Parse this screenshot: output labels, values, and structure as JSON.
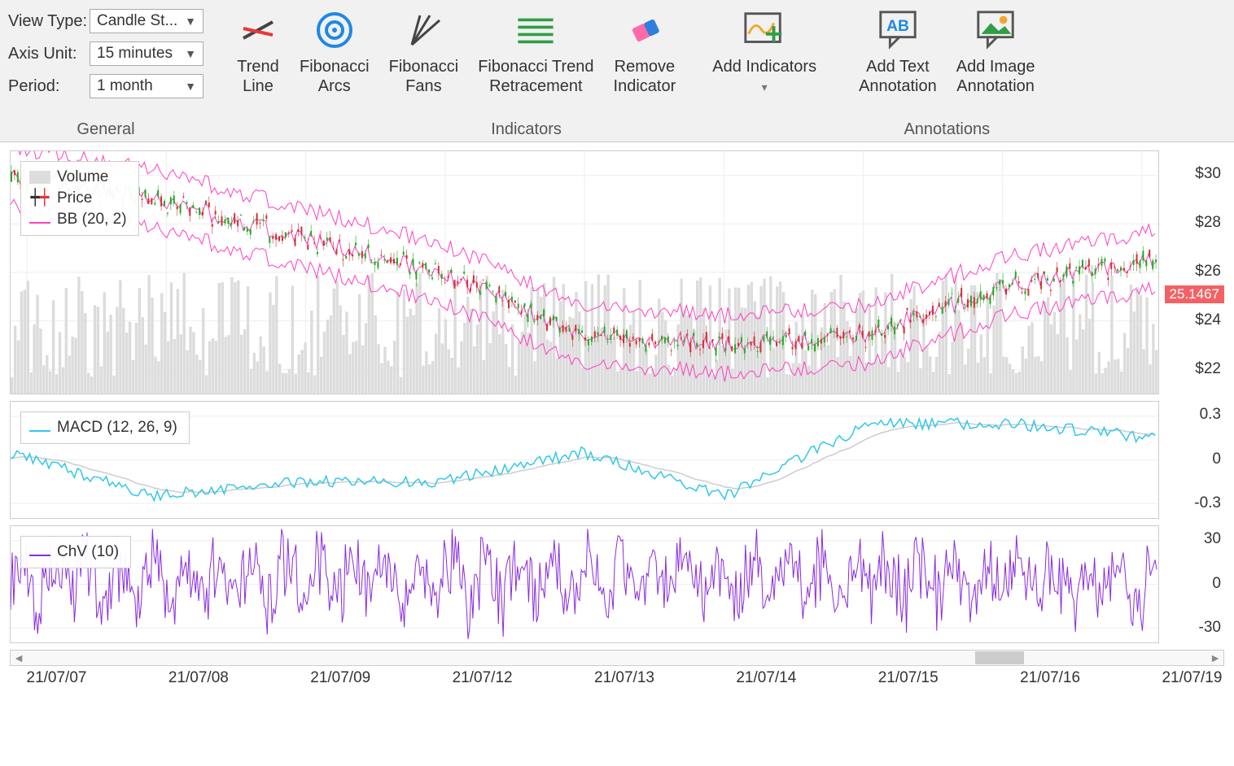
{
  "ribbon": {
    "general": {
      "title": "General",
      "view_type_label": "View Type:",
      "view_type_value": "Candle St...",
      "axis_unit_label": "Axis Unit:",
      "axis_unit_value": "15 minutes",
      "period_label": "Period:",
      "period_value": "1 month"
    },
    "indicators": {
      "title": "Indicators",
      "trend_line": "Trend\nLine",
      "fib_arcs": "Fibonacci\nArcs",
      "fib_fans": "Fibonacci\nFans",
      "fib_retr": "Fibonacci Trend\nRetracement",
      "remove": "Remove\nIndicator",
      "add": "Add Indicators"
    },
    "annotations": {
      "title": "Annotations",
      "add_text": "Add Text\nAnnotation",
      "add_image": "Add Image\nAnnotation"
    }
  },
  "main_pane": {
    "legend": {
      "volume": "Volume",
      "price": "Price",
      "bb": "BB (20, 2)"
    },
    "y_ticks": [
      "$30",
      "$28",
      "$26",
      "$24",
      "$22"
    ],
    "price_tag": "25.1467"
  },
  "macd_pane": {
    "legend": "MACD (12, 26, 9)",
    "y_ticks": [
      "0.3",
      "0",
      "-0.3"
    ]
  },
  "chv_pane": {
    "legend": "ChV (10)",
    "y_ticks": [
      "30",
      "0",
      "-30"
    ]
  },
  "x_ticks": [
    "21/07/07",
    "21/07/08",
    "21/07/09",
    "21/07/12",
    "21/07/13",
    "21/07/14",
    "21/07/15",
    "21/07/16",
    "21/07/19"
  ],
  "colors": {
    "bb": "#ff3fc2",
    "macd": "#33c7e8",
    "chv": "#8a2be2",
    "vol": "#cccccc",
    "accent_green": "#2f9e44",
    "accent_blue": "#1e88e5",
    "eraser_pink": "#ff6aa9",
    "eraser_blue": "#2e7fdc",
    "orange": "#f4a62a",
    "badge_red": "#f26265"
  },
  "chart_data": {
    "type": "candlestick-with-indicators",
    "x_categories": [
      "21/07/07",
      "21/07/08",
      "21/07/09",
      "21/07/12",
      "21/07/13",
      "21/07/14",
      "21/07/15",
      "21/07/16",
      "21/07/19"
    ],
    "price_axis": {
      "min": 21,
      "max": 31,
      "ticks": [
        22,
        24,
        26,
        28,
        30
      ],
      "last_value": 25.1467
    },
    "price_mid_approx_per_day": [
      30.0,
      29.0,
      27.5,
      26.0,
      23.5,
      23.0,
      23.5,
      25.5,
      26.5
    ],
    "bb_bandwidth_approx": 2.0,
    "macd_axis": {
      "min": -0.4,
      "max": 0.4,
      "ticks": [
        -0.3,
        0,
        0.3
      ]
    },
    "macd_approx_per_day": [
      0.05,
      -0.25,
      -0.15,
      -0.15,
      0.05,
      -0.25,
      0.25,
      0.25,
      0.15
    ],
    "chv_axis": {
      "min": -40,
      "max": 40,
      "ticks": [
        -30,
        0,
        30
      ]
    },
    "chv_range_approx": [
      -25,
      35
    ]
  }
}
